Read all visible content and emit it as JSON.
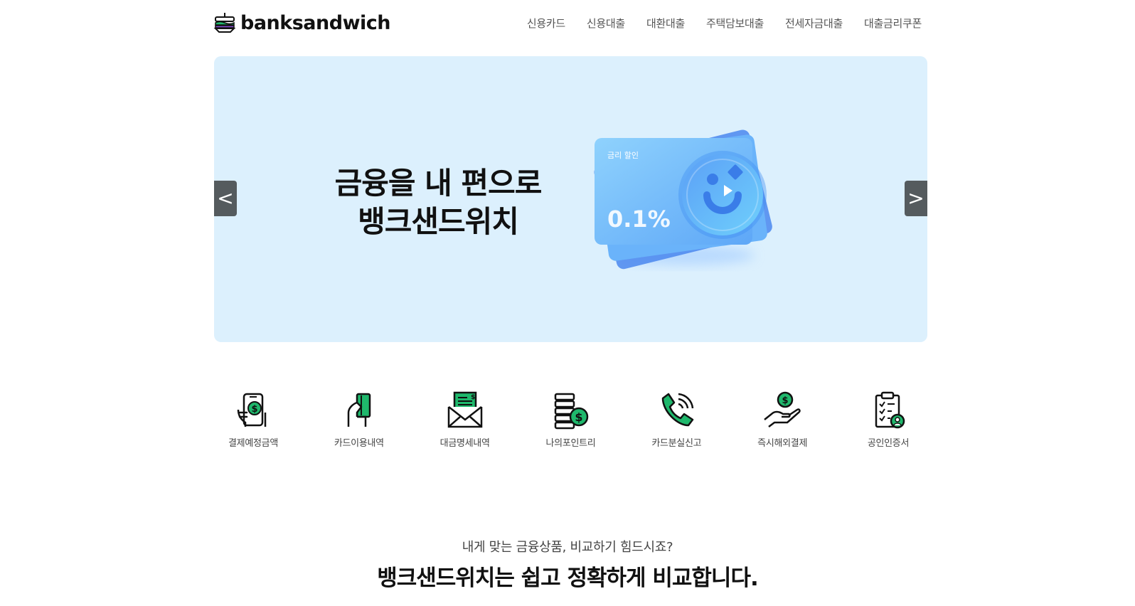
{
  "header": {
    "logo_text": "banksandwich",
    "nav": [
      "신용카드",
      "신용대출",
      "대환대출",
      "주택담보대출",
      "전세자금대출",
      "대출금리쿠폰"
    ]
  },
  "hero": {
    "title_line1": "금융을 내 편으로",
    "title_line2": "뱅크샌드위치",
    "card_label": "금리 할인",
    "card_rate": "0.1%",
    "prev_label": "<",
    "next_label": ">",
    "background": "#dcf0fd"
  },
  "quick_menu": [
    {
      "label": "결제예정금액",
      "icon": "phone-dollar-icon"
    },
    {
      "label": "카드이용내역",
      "icon": "hand-card-icon"
    },
    {
      "label": "대금명세내역",
      "icon": "envelope-statement-icon"
    },
    {
      "label": "나의포인트리",
      "icon": "coins-icon"
    },
    {
      "label": "카드분실신고",
      "icon": "phone-call-icon"
    },
    {
      "label": "즉시해외결제",
      "icon": "hand-coin-icon"
    },
    {
      "label": "공인인증서",
      "icon": "clipboard-user-icon"
    }
  ],
  "intro": {
    "subtitle": "내게 맞는 금융상품, 비교하기 힘드시죠?",
    "headline": "뱅크샌드위치는 쉽고 정확하게 비교합니다."
  },
  "colors": {
    "accent_green": "#1fb86c",
    "hero_bg": "#dcf0fd",
    "arrow_bg": "#555b5e"
  }
}
